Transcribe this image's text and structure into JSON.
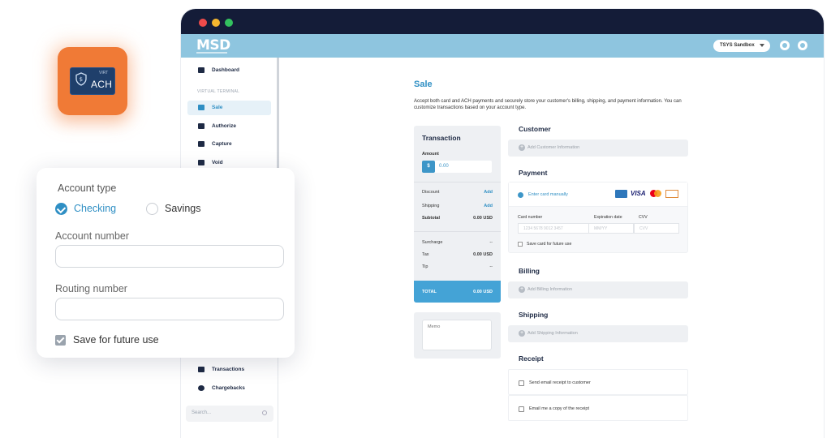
{
  "ach_icon": {
    "label": "ACH",
    "sub": "VIRT"
  },
  "appbar": {
    "logo": "MSD",
    "environment": "TSYS Sandbox"
  },
  "sidebar": {
    "items": [
      {
        "label": "Dashboard",
        "icon": "home-icon"
      },
      {
        "label": "Sale",
        "icon": "register-icon"
      },
      {
        "label": "Authorize",
        "icon": "card-icon"
      },
      {
        "label": "Capture",
        "icon": "capture-icon"
      },
      {
        "label": "Void",
        "icon": "truck-icon"
      }
    ],
    "section_label": "VIRTUAL TERMINAL",
    "lower_items": [
      {
        "label": "Transactions",
        "icon": "receipt-icon"
      },
      {
        "label": "Chargebacks",
        "icon": "refresh-icon"
      }
    ],
    "search_placeholder": "Search..."
  },
  "page": {
    "title": "Sale",
    "description": "Accept both card and ACH payments and securely store your customer's billing, shipping, and payment information. You can customize transactions based on your account type."
  },
  "transaction": {
    "title": "Transaction",
    "amount_label": "Amount",
    "currency_symbol": "$",
    "amount_value": "0.00",
    "discount_label": "Discount",
    "discount_action": "Add",
    "shipping_label": "Shipping",
    "shipping_action": "Add",
    "subtotal_label": "Subtotal",
    "subtotal_value": "0.00 USD",
    "surcharge_label": "Surcharge",
    "surcharge_value": "--",
    "tax_label": "Tax",
    "tax_value": "0.00 USD",
    "tip_label": "Tip",
    "tip_value": "--",
    "total_label": "TOTAL",
    "total_value": "0.00 USD",
    "memo_placeholder": "Memo"
  },
  "customer": {
    "title": "Customer",
    "add_label": "Add Customer Information"
  },
  "payment": {
    "title": "Payment",
    "enter_manual_label": "Enter card manually",
    "visa_text": "VISA",
    "card_number_label": "Card number",
    "card_number_placeholder": "1234 5678 9012 3457",
    "expiration_label": "Expiration date",
    "expiration_placeholder": "MM/YY",
    "cvv_label": "CVV",
    "cvv_placeholder": "CVV",
    "save_card_label": "Save card for future use"
  },
  "billing": {
    "title": "Billing",
    "add_label": "Add Billing Information"
  },
  "shipping": {
    "title": "Shipping",
    "add_label": "Add Shipping Information"
  },
  "receipt": {
    "title": "Receipt",
    "option_customer": "Send email receipt to customer",
    "option_me": "Email me a copy of the receipt"
  },
  "ach_form": {
    "account_type_label": "Account type",
    "option_checking": "Checking",
    "option_savings": "Savings",
    "selected": "Checking",
    "account_number_label": "Account number",
    "account_number_value": "",
    "routing_number_label": "Routing number",
    "routing_number_value": "",
    "save_label": "Save for future use",
    "save_checked": true
  },
  "colors": {
    "accent": "#2f8fc4",
    "appbar": "#8ec5df",
    "titlebar": "#141c38",
    "ach_icon": "#f07a36"
  }
}
